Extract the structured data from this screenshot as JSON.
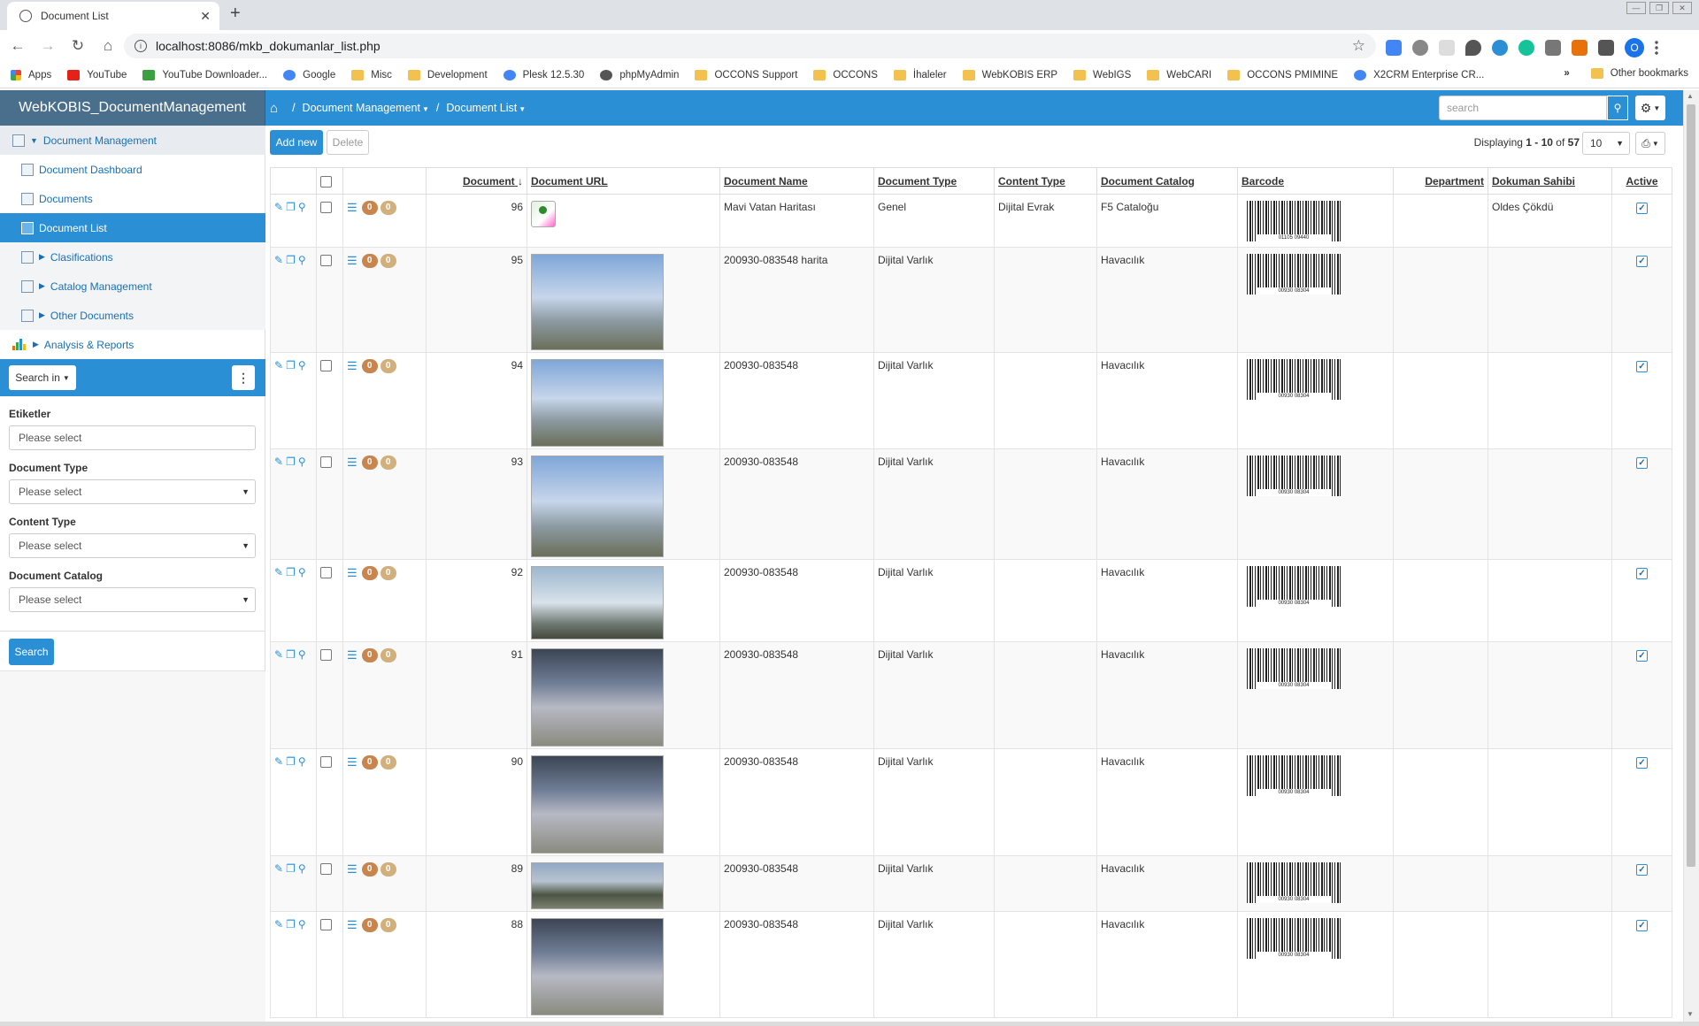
{
  "browser": {
    "tab_title": "Document List",
    "tab_close": "✕",
    "new_tab": "+",
    "url": "localhost:8086/mkb_dokumanlar_list.php",
    "profile_initial": "O",
    "bookmarks": [
      "Apps",
      "YouTube",
      "YouTube Downloader...",
      "Google",
      "Misc",
      "Development",
      "Plesk 12.5.30",
      "phpMyAdmin",
      "OCCONS Support",
      "OCCONS",
      "İhaleler",
      "WebKOBIS ERP",
      "WebIGS",
      "WebCARI",
      "OCCONS PMIMINE",
      "X2CRM Enterprise CR..."
    ],
    "bookmarks_overflow": "»",
    "other_bookmarks": "Other bookmarks"
  },
  "app": {
    "brand": "WebKOBIS_DocumentManagement",
    "breadcrumb": [
      "Document Management",
      "Document List"
    ],
    "search_placeholder": "search",
    "accent_color": "#2b8fd6"
  },
  "sidebar": {
    "items": [
      {
        "label": "Document Management"
      },
      {
        "label": "Document Dashboard"
      },
      {
        "label": "Documents"
      },
      {
        "label": "Document List"
      },
      {
        "label": "Clasifications"
      },
      {
        "label": "Catalog Management"
      },
      {
        "label": "Other Documents"
      },
      {
        "label": "Analysis & Reports"
      }
    ],
    "search_in": "Search in",
    "filters": [
      {
        "label": "Etiketler",
        "value": "Please select"
      },
      {
        "label": "Document Type",
        "value": "Please select"
      },
      {
        "label": "Content Type",
        "value": "Please select"
      },
      {
        "label": "Document Catalog",
        "value": "Please select"
      }
    ],
    "search_button": "Search"
  },
  "toolbar": {
    "add_new": "Add new",
    "delete": "Delete",
    "displaying_prefix": "Displaying ",
    "range": "1 - 10",
    "of_text": " of ",
    "total": "57",
    "per_page": "10"
  },
  "table": {
    "columns": [
      "Document",
      "Document URL",
      "Document Name",
      "Document Type",
      "Content Type",
      "Document Catalog",
      "Barcode",
      "Department",
      "Dokuman Sahibi",
      "Active"
    ],
    "badge_values": [
      "0",
      "0"
    ],
    "rows": [
      {
        "id": "96",
        "name": "Mavi Vatan Haritası",
        "type": "Genel",
        "content": "Dijital Evrak",
        "catalog": "F5 Cataloğu",
        "barcode": "01105 09440",
        "dept": "",
        "owner": "Oldes Çökdü",
        "active": true,
        "thumb": "map-icon"
      },
      {
        "id": "95",
        "name": "200930-083548 harita",
        "type": "Dijital Varlık",
        "content": "",
        "catalog": "Havacılık",
        "barcode": "00930 08304",
        "dept": "",
        "owner": "",
        "active": true,
        "thumb": "jet-photo"
      },
      {
        "id": "94",
        "name": "200930-083548",
        "type": "Dijital Varlık",
        "content": "",
        "catalog": "Havacılık",
        "barcode": "00930 08304",
        "dept": "",
        "owner": "",
        "active": true,
        "thumb": "jet-photo"
      },
      {
        "id": "93",
        "name": "200930-083548",
        "type": "Dijital Varlık",
        "content": "",
        "catalog": "Havacılık",
        "barcode": "00930 08304",
        "dept": "",
        "owner": "",
        "active": true,
        "thumb": "jet-photo"
      },
      {
        "id": "92",
        "name": "200930-083548",
        "type": "Dijital Varlık",
        "content": "",
        "catalog": "Havacılık",
        "barcode": "00930 08304",
        "dept": "",
        "owner": "",
        "active": true,
        "thumb": "helicopter-photo"
      },
      {
        "id": "91",
        "name": "200930-083548",
        "type": "Dijital Varlık",
        "content": "",
        "catalog": "Havacılık",
        "barcode": "00930 08304",
        "dept": "",
        "owner": "",
        "active": true,
        "thumb": "hangar-photo"
      },
      {
        "id": "90",
        "name": "200930-083548",
        "type": "Dijital Varlık",
        "content": "",
        "catalog": "Havacılık",
        "barcode": "00930 08304",
        "dept": "",
        "owner": "",
        "active": true,
        "thumb": "hangar-photo"
      },
      {
        "id": "89",
        "name": "200930-083548",
        "type": "Dijital Varlık",
        "content": "",
        "catalog": "Havacılık",
        "barcode": "00930 08304",
        "dept": "",
        "owner": "",
        "active": true,
        "thumb": "airfield-photo"
      },
      {
        "id": "88",
        "name": "200930-083548",
        "type": "Dijital Varlık",
        "content": "",
        "catalog": "Havacılık",
        "barcode": "00930 08304",
        "dept": "",
        "owner": "",
        "active": true,
        "thumb": "hangar-photo"
      }
    ]
  }
}
